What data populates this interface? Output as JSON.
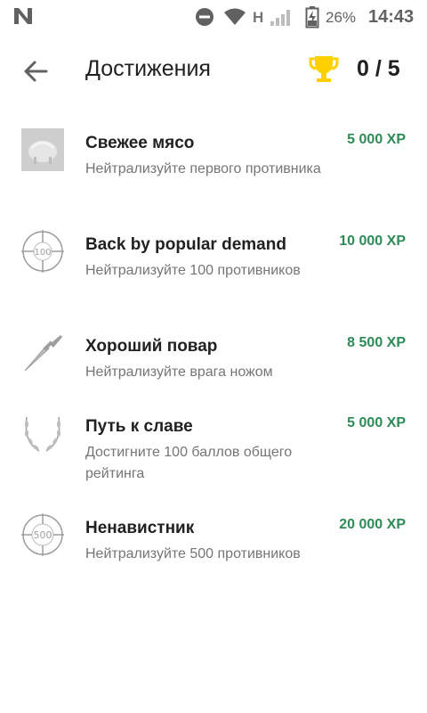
{
  "status_bar": {
    "network_type": "H",
    "battery_percent": "26%",
    "time": "14:43",
    "icons": [
      "notification-n-icon",
      "do-not-disturb-icon",
      "wifi-icon",
      "signal-icon",
      "battery-charging-icon"
    ]
  },
  "toolbar": {
    "back_icon": "arrow-back-icon",
    "title": "Достижения",
    "trophy_icon": "trophy-icon",
    "trophy_color": "#ffd000",
    "counter": "0 / 5"
  },
  "colors": {
    "xp": "#2e8b57"
  },
  "achievements": [
    {
      "icon": "fresh-meat-icon",
      "title": "Свежее мясо",
      "description": "Нейтрализуйте первого противника",
      "xp": "5 000 XP"
    },
    {
      "icon": "crosshair-100-icon",
      "title": "Back by popular demand",
      "description": "Нейтрализуйте 100 противников",
      "xp": "10 000 XP"
    },
    {
      "icon": "knife-icon",
      "title": "Хороший повар",
      "description": "Нейтрализуйте врага ножом",
      "xp": "8 500 XP"
    },
    {
      "icon": "laurel-wreath-icon",
      "title": "Путь к славе",
      "description": "Достигните 100 баллов общего рейтинга",
      "xp": "5 000 XP"
    },
    {
      "icon": "crosshair-500-icon",
      "title": "Ненавистник",
      "description": "Нейтрализуйте 500 противников",
      "xp": "20 000 XP"
    }
  ]
}
